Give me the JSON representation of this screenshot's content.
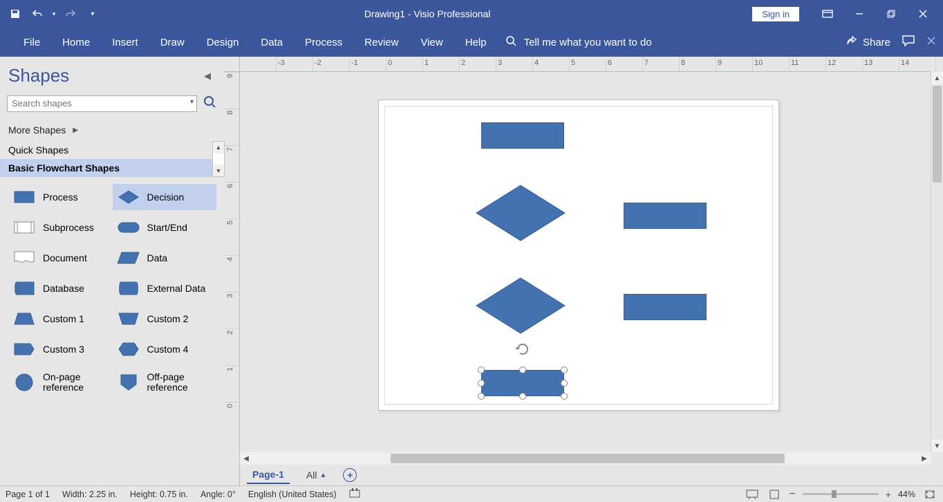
{
  "title": "Drawing1  -  Visio Professional",
  "signin": "Sign in",
  "tabs": [
    "File",
    "Home",
    "Insert",
    "Draw",
    "Design",
    "Data",
    "Process",
    "Review",
    "View",
    "Help"
  ],
  "tellme": "Tell me what you want to do",
  "share": "Share",
  "shapes_panel": {
    "title": "Shapes",
    "search_placeholder": "Search shapes",
    "more": "More Shapes",
    "quick": "Quick Shapes",
    "basic": "Basic Flowchart Shapes",
    "items": [
      {
        "name": "Process"
      },
      {
        "name": "Decision"
      },
      {
        "name": "Subprocess"
      },
      {
        "name": "Start/End"
      },
      {
        "name": "Document"
      },
      {
        "name": "Data"
      },
      {
        "name": "Database"
      },
      {
        "name": "External Data"
      },
      {
        "name": "Custom 1"
      },
      {
        "name": "Custom 2"
      },
      {
        "name": "Custom 3"
      },
      {
        "name": "Custom 4"
      },
      {
        "name": "On-page reference"
      },
      {
        "name": "Off-page reference"
      }
    ]
  },
  "ruler_h": [
    "",
    "-3",
    "-2",
    "-1",
    "0",
    "1",
    "2",
    "3",
    "4",
    "5",
    "6",
    "7",
    "8",
    "9",
    "10",
    "11",
    "12",
    "13",
    "14"
  ],
  "ruler_v": [
    "9",
    "8",
    "7",
    "6",
    "5",
    "4",
    "3",
    "2",
    "1",
    "0"
  ],
  "page_tabs": {
    "page1": "Page-1",
    "all": "All"
  },
  "status": {
    "page": "Page 1 of 1",
    "width": "Width: 2.25 in.",
    "height": "Height: 0.75 in.",
    "angle": "Angle: 0°",
    "lang": "English (United States)",
    "zoom": "44%"
  }
}
